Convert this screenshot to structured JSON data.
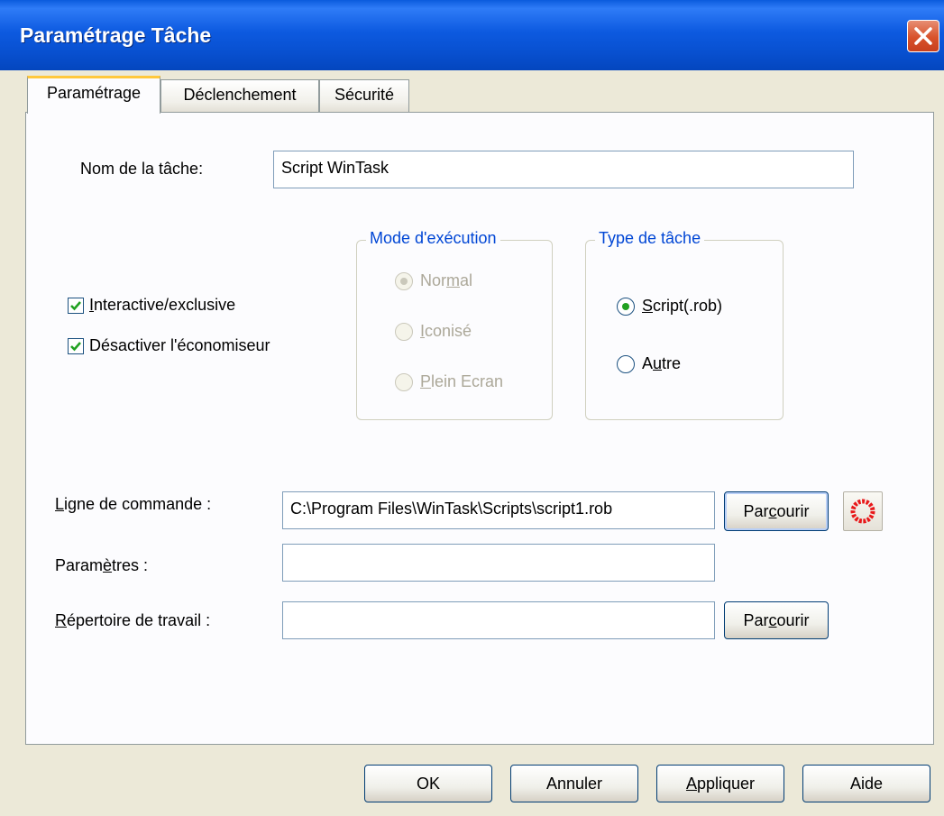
{
  "window": {
    "title": "Paramétrage Tâche"
  },
  "tabs": [
    {
      "label": "Paramétrage",
      "active": true
    },
    {
      "label": "Déclenchement",
      "active": false
    },
    {
      "label": "Sécurité",
      "active": false
    }
  ],
  "task_name": {
    "label": "Nom de la tâche:",
    "value": "Script WinTask"
  },
  "options": {
    "interactive": {
      "label_underline": "I",
      "label_rest": "nteractive/exclusive",
      "checked": true
    },
    "screensaver": {
      "label": "Désactiver l'économiseur",
      "checked": true
    }
  },
  "exec_mode": {
    "legend": "Mode d'exécution",
    "normal": {
      "before": "Nor",
      "underline": "m",
      "after": "al",
      "selected": true
    },
    "iconise": {
      "before": "",
      "underline": "I",
      "after": "conisé",
      "selected": false
    },
    "fullscreen": {
      "before": "",
      "underline": "P",
      "after": "lein Ecran",
      "selected": false
    }
  },
  "task_type": {
    "legend": "Type de tâche",
    "script": {
      "before": "",
      "underline": "S",
      "after": "cript(.rob)",
      "selected": true
    },
    "other": {
      "before": "A",
      "underline": "u",
      "after": "tre",
      "selected": false
    }
  },
  "command_line": {
    "label_before": "",
    "label_underline": "L",
    "label_after": "igne de commande :",
    "value": "C:\\Program Files\\WinTask\\Scripts\\script1.rob",
    "browse": {
      "before": "Par",
      "underline": "c",
      "after": "ourir"
    }
  },
  "parameters": {
    "label_before": "Param",
    "label_underline": "è",
    "label_after": "tres :",
    "value": ""
  },
  "working_dir": {
    "label_before": "",
    "label_underline": "R",
    "label_after": "épertoire de travail :",
    "value": "",
    "browse": {
      "before": "Par",
      "underline": "c",
      "after": "ourir"
    }
  },
  "buttons": {
    "ok": "OK",
    "cancel": "Annuler",
    "apply": {
      "before": "",
      "underline": "A",
      "after": "ppliquer"
    },
    "help": "Aide"
  },
  "colors": {
    "titlebar": "#0A5BDD",
    "dialog_bg": "#ECE9D8",
    "group_legend": "#0046D5",
    "check": "#21A121"
  },
  "icons": {
    "close": "close-icon",
    "record": "record-icon"
  }
}
